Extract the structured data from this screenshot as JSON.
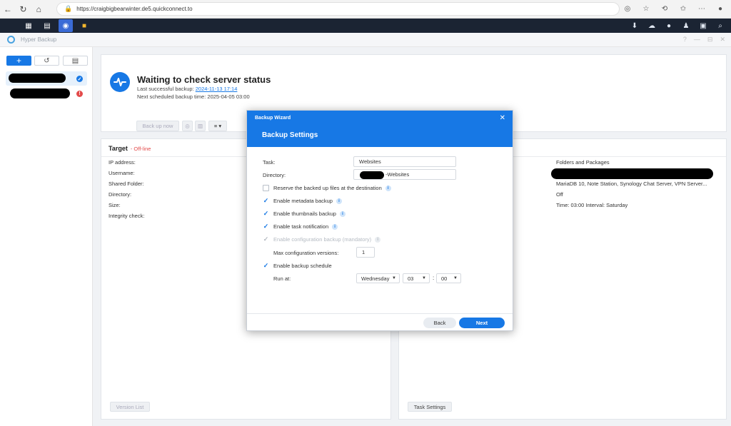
{
  "browser": {
    "url": "https://craigbigbearwinter.de5.quickconnect.to"
  },
  "app": {
    "title": "Hyper Backup",
    "window_controls": [
      "?",
      "—",
      "⊟",
      "✕"
    ]
  },
  "sidebar": {
    "buttons": [
      {
        "name": "add",
        "glyph": "+"
      },
      {
        "name": "restore",
        "glyph": "↺"
      },
      {
        "name": "log",
        "glyph": "▤"
      }
    ]
  },
  "main": {
    "status_title": "Waiting to check server status",
    "last_backup_label": "Last successful backup:",
    "last_backup_value": "2024-11-13 17:14",
    "next_backup_label": "Next scheduled backup time:",
    "next_backup_value": "2025-04-05 03:00",
    "toolbar": {
      "backup_now": "Back up now"
    }
  },
  "target": {
    "title": "Target",
    "status": "- Off-line",
    "fields": [
      "IP address:",
      "Username:",
      "Shared Folder:",
      "Directory:",
      "Size:",
      "Integrity check:"
    ],
    "version_list_label": "Version List"
  },
  "source": {
    "values": [
      "Folders and Packages",
      "",
      "MariaDB 10, Note Station, Synology Chat Server, VPN Server...",
      "Off",
      "Time: 03:00 Interval: Saturday"
    ],
    "task_settings_label": "Task Settings"
  },
  "wizard": {
    "header": "Backup Wizard",
    "title": "Backup Settings",
    "task_label": "Task:",
    "task_value": "Websites",
    "directory_label": "Directory:",
    "directory_value": "-Websites",
    "options": {
      "reserve": "Reserve the backed up files at the destination",
      "metadata": "Enable metadata backup",
      "thumbnails": "Enable thumbnails backup",
      "notification": "Enable task notification",
      "config": "Enable configuration backup (mandatory)",
      "max_config_label": "Max configuration versions:",
      "max_config_value": "1",
      "schedule": "Enable backup schedule",
      "run_at_label": "Run at:",
      "day": "Wednesday",
      "hour": "03",
      "minute": "00"
    },
    "back_label": "Back",
    "next_label": "Next"
  },
  "colors": {
    "accent": "#1778e5",
    "taskbar": "#1b2433",
    "offline": "#e34a4a"
  }
}
